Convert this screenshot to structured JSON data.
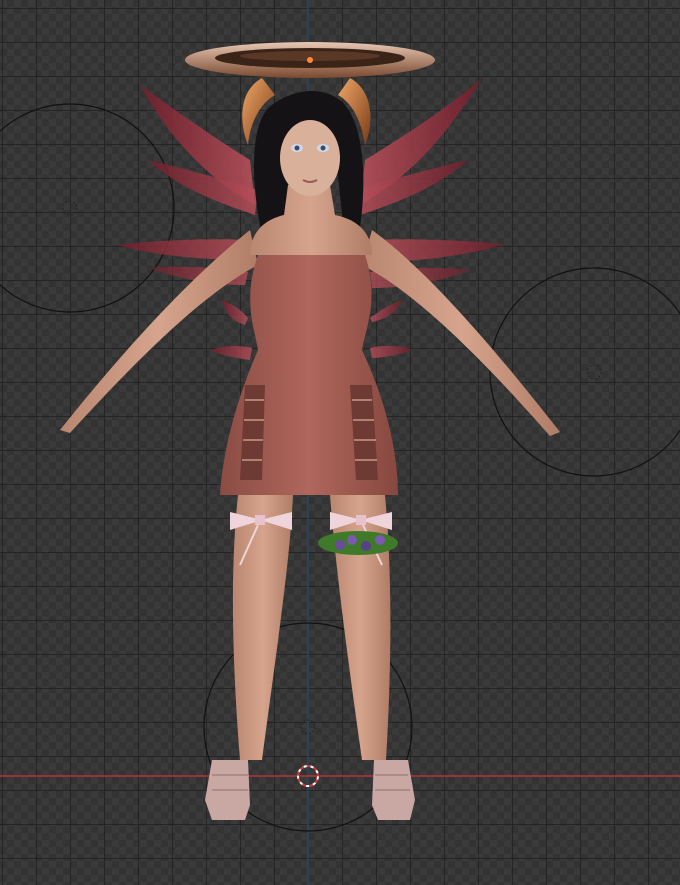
{
  "viewport": {
    "mode": "3d-viewport-front-view",
    "grid": true,
    "colors": {
      "background": "#3a3a3a",
      "grid_line": "#1e1e1e",
      "axis_x": "#b0343a",
      "axis_z": "#2f4f7a",
      "empty_circle": "#111111"
    }
  },
  "scene": {
    "object": "character-model",
    "icons": [
      "halo-icon",
      "horns-icon",
      "wings-icon",
      "origin-cursor-icon",
      "empty-object-icon"
    ]
  }
}
